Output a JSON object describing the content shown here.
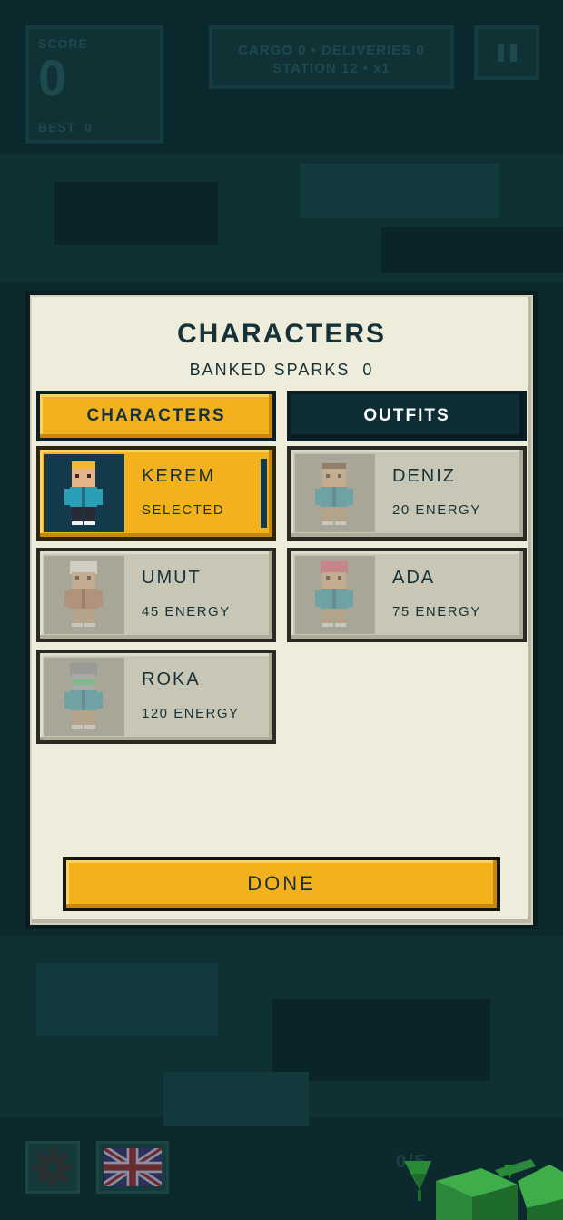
{
  "hud": {
    "score_label": "SCORE",
    "score_value": "0",
    "best_label": "BEST",
    "best_value": "0",
    "stats_line1": "CARGO 0  •  DELIVERIES 0",
    "stats_line2": "STATION 12  •  x1",
    "progress_text": "0/5"
  },
  "modal": {
    "title": "CHARACTERS",
    "sparks_label": "BANKED SPARKS",
    "sparks_value": "0",
    "tabs": [
      {
        "label": "CHARACTERS",
        "active": true
      },
      {
        "label": "OUTFITS",
        "active": false
      }
    ],
    "characters": [
      {
        "name": "KEREM",
        "status": "SELECTED",
        "selected": true,
        "hair": "#f2b92e",
        "icon": "character-kerem-icon"
      },
      {
        "name": "DENIZ",
        "status": "20 ENERGY",
        "selected": false,
        "hair": "#7a4f36",
        "icon": "character-deniz-icon"
      },
      {
        "name": "UMUT",
        "status": "45 ENERGY",
        "selected": false,
        "hair": "#ffffff",
        "icon": "character-umut-icon"
      },
      {
        "name": "ADA",
        "status": "75 ENERGY",
        "selected": false,
        "hair": "#e8607a",
        "icon": "character-ada-icon"
      },
      {
        "name": "ROKA",
        "status": "120 ENERGY",
        "selected": false,
        "hair": "#8a8f99",
        "icon": "character-roka-icon"
      }
    ],
    "done_label": "DONE"
  },
  "colors": {
    "accent": "#f4b11e",
    "dark": "#0e2e35",
    "panel": "#eeecda",
    "locked_card": "#c8c6b4"
  }
}
